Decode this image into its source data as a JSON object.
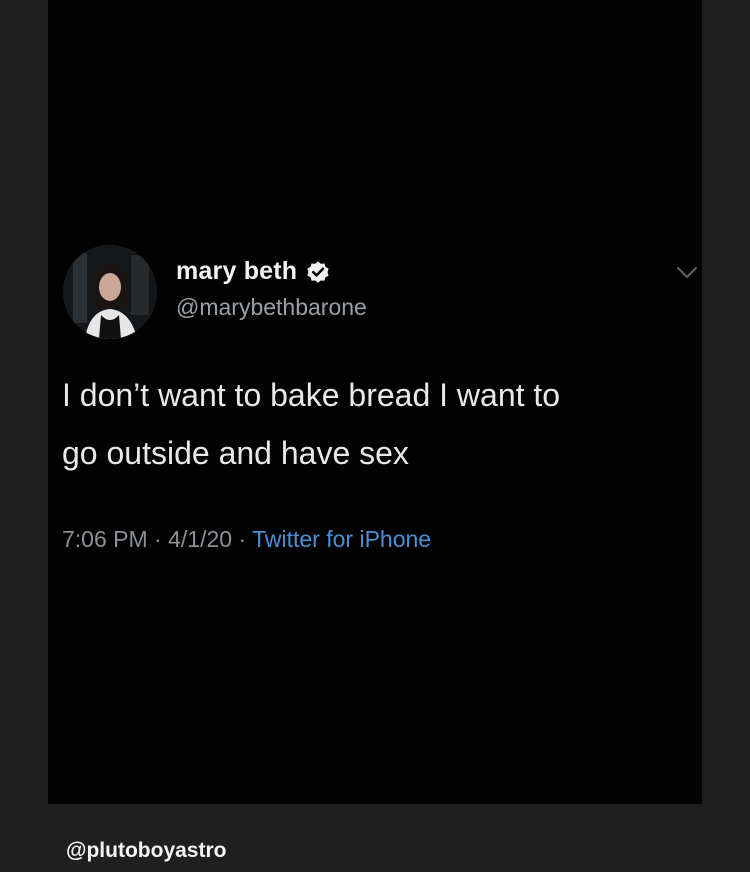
{
  "tweet": {
    "display_name": "mary beth",
    "handle": "@marybethbarone",
    "text": "I don’t want to bake bread I want to\ngo outside and have sex",
    "time": "7:06 PM",
    "separator": "·",
    "date": "4/1/20",
    "source": "Twitter for iPhone",
    "verified_icon": "verified-badge-icon",
    "menu_icon": "chevron-down-icon"
  },
  "post": {
    "credit": "@plutoboyastro"
  },
  "colors": {
    "page_background": "#1f1f1f",
    "tweet_background": "#020202",
    "name_color": "#f2f2f2",
    "handle_color": "#9aa0a6",
    "source_link_color": "#4a8fd6"
  }
}
